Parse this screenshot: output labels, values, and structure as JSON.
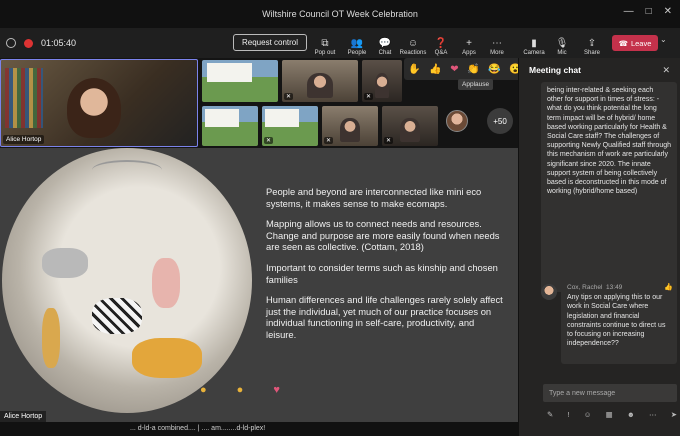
{
  "window": {
    "title": "Wiltshire Council OT Week Celebration",
    "controls": [
      "—",
      "□",
      "✕"
    ]
  },
  "toolbar": {
    "timer": "01:05:40",
    "request_control": "Request control",
    "buttons": [
      {
        "label": "Pop out",
        "icon": "popout-icon",
        "glyph": "⧉"
      },
      {
        "label": "People",
        "icon": "people-icon",
        "glyph": "👥"
      },
      {
        "label": "Chat",
        "icon": "chat-icon",
        "glyph": "💬"
      },
      {
        "label": "Reactions",
        "icon": "reactions-icon",
        "glyph": "☺"
      },
      {
        "label": "Q&A",
        "icon": "qa-icon",
        "glyph": "❓"
      },
      {
        "label": "Apps",
        "icon": "apps-icon",
        "glyph": "+"
      },
      {
        "label": "More",
        "icon": "more-icon",
        "glyph": "⋯"
      },
      {
        "label": "Camera",
        "icon": "camera-icon",
        "glyph": "▮"
      },
      {
        "label": "Mic",
        "icon": "mic-icon",
        "glyph": "🎙"
      },
      {
        "label": "Share",
        "icon": "share-icon",
        "glyph": "⇪"
      }
    ],
    "leave": "Leave"
  },
  "reactions": {
    "items": [
      "✋",
      "👍",
      "❤",
      "👏",
      "😂",
      "😮"
    ],
    "tooltip": "Applause"
  },
  "participants": {
    "main_name": "Alice Hortop",
    "more_count": "+50"
  },
  "slide": {
    "paragraphs": [
      "People and beyond are interconnected like mini eco systems, it makes sense to make ecomaps.",
      "Mapping allows us to connect needs and resources. Change and purpose are more easily found when needs are seen as collective. (Cottam, 2018)",
      "Important to consider terms such as kinship and chosen families",
      "Human differences and life challenges rarely solely affect just the individual, yet much of our practice focuses on individual functioning in self-care, productivity, and leisure."
    ],
    "presenter": "Alice Hortop"
  },
  "caption": "... d-ld-a combined.... | .... am........d-ld-plex!",
  "chat": {
    "title": "Meeting chat",
    "message1": "being inter-related & seeking each other for support in times of stress: - what do you think potential the long term impact will be of hybrid/ home based working particularly for Health & Social Care staff? The challenges of supporting Newly Qualified staff through this mechanism of work are particularly significant since 2020. The innate support system of being collectively based is deconstructed in this mode of working (hybrid/home based)",
    "message2": {
      "author": "Cox, Rachel",
      "time": "13:49",
      "text": "Any tips on applying this to our work in Social Care where legislation and financial constraints continue to direct us to focusing on increasing independence??"
    },
    "compose_placeholder": "Type a new message",
    "compose_tools": [
      "✎",
      "!",
      "☺",
      "▦",
      "☻",
      "⋯",
      "➤"
    ]
  },
  "colors": {
    "leave": "#c4314b",
    "accent": "#7b83eb",
    "panel": "#252423"
  }
}
